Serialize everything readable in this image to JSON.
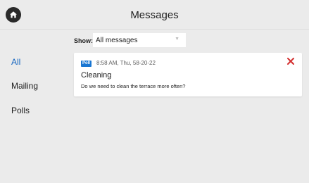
{
  "header": {
    "title": "Messages",
    "home_icon": "home-icon"
  },
  "sidebar": {
    "items": [
      {
        "label": "All",
        "active": true
      },
      {
        "label": "Mailing",
        "active": false
      },
      {
        "label": "Polls",
        "active": false
      }
    ]
  },
  "filter": {
    "label": "Show:",
    "selected": "All messages"
  },
  "messages": [
    {
      "badge": "Poll",
      "timestamp": "8:58 AM, Thu, 58-20-22",
      "title": "Cleaning",
      "body": "Do we need to clean the terrace more often?"
    }
  ],
  "colors": {
    "background": "#ebebeb",
    "accent": "#1565c0",
    "badge": "#1976d2",
    "close": "#d32f2f"
  }
}
